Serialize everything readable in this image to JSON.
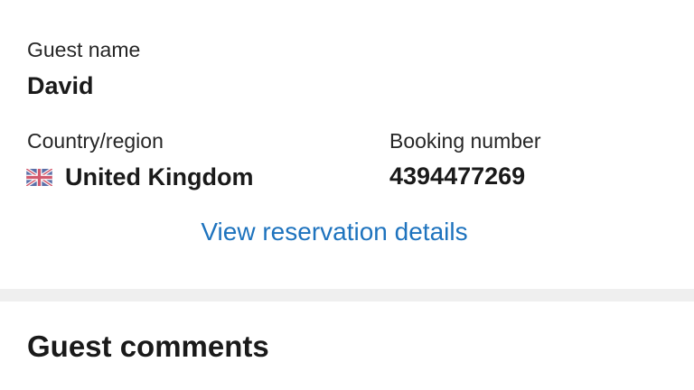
{
  "guest": {
    "name_label": "Guest name",
    "name_value": "David"
  },
  "country": {
    "label": "Country/region",
    "value": "United Kingdom",
    "flag_icon": "uk-flag-icon"
  },
  "booking": {
    "label": "Booking number",
    "value": "4394477269"
  },
  "actions": {
    "view_details_label": "View reservation details"
  },
  "comments": {
    "title": "Guest comments"
  },
  "colors": {
    "link": "#1e73be",
    "divider": "#efefef",
    "text": "#1a1a1a"
  }
}
